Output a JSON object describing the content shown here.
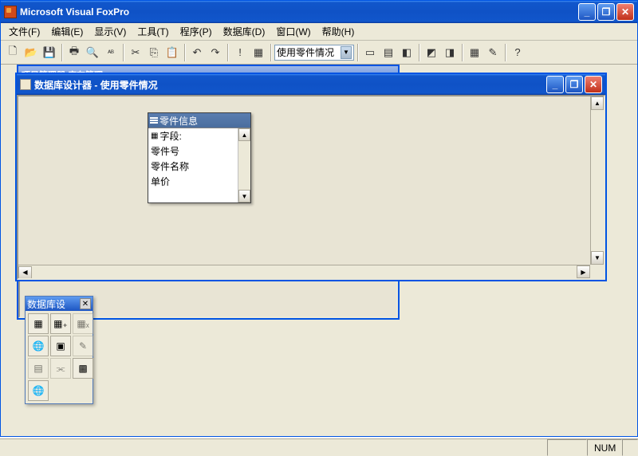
{
  "app": {
    "title": "Microsoft Visual FoxPro",
    "menus": [
      {
        "label": "文件(F)"
      },
      {
        "label": "编辑(E)"
      },
      {
        "label": "显示(V)"
      },
      {
        "label": "工具(T)"
      },
      {
        "label": "程序(P)"
      },
      {
        "label": "数据库(D)"
      },
      {
        "label": "窗口(W)"
      },
      {
        "label": "帮助(H)"
      }
    ],
    "combo_value": "使用零件情况"
  },
  "bg_window": {
    "title": "项目管理器    库存管理"
  },
  "db_window": {
    "title": "数据库设计器 - 使用零件情况"
  },
  "table": {
    "title": "零件信息",
    "fields_header": "字段:",
    "fields": [
      "零件号",
      "零件名称",
      "单价"
    ]
  },
  "toolbox": {
    "title": "数据库设"
  },
  "status": {
    "num": "NUM"
  }
}
